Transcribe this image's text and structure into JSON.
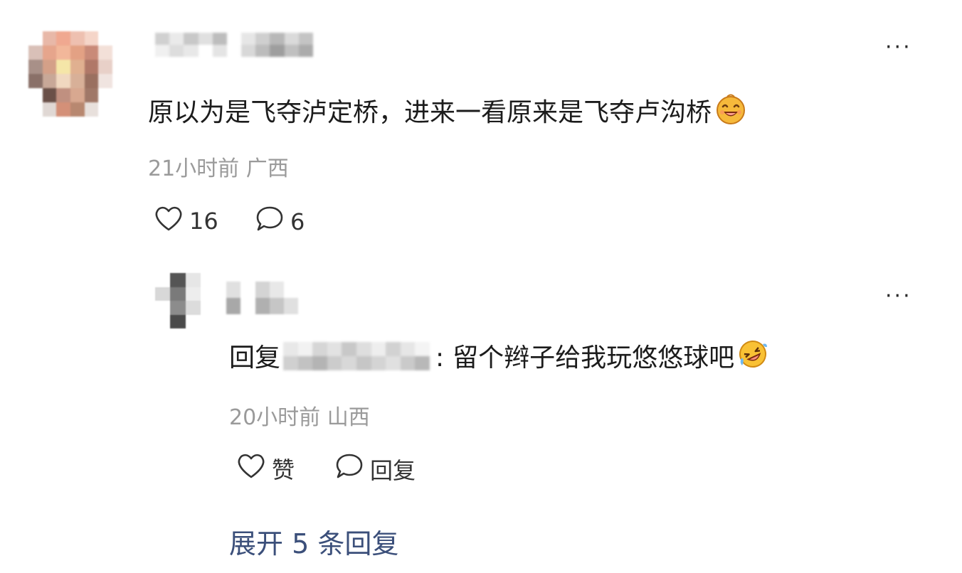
{
  "comment": {
    "text": "原以为是飞夺泸定桥，进来一看原来是飞夺卢沟桥",
    "emoji_icon": "laughing-face-emoji-icon",
    "time": "21小时前",
    "location": "广西",
    "likes": "16",
    "replies_count": "6",
    "more_icon": "more-options-icon"
  },
  "reply": {
    "prefix": "回复",
    "separator": ":",
    "text": "留个辫子给我玩悠悠球吧",
    "emoji_icon": "rolling-laughing-emoji-icon",
    "time": "20小时前",
    "location": "山西",
    "like_label": "赞",
    "reply_label": "回复",
    "more_icon": "more-options-icon"
  },
  "expand": {
    "label": "展开 5 条回复"
  },
  "colors": {
    "link": "#3b4f7a",
    "meta": "#9a9a9a",
    "text": "#1c1c1c"
  }
}
